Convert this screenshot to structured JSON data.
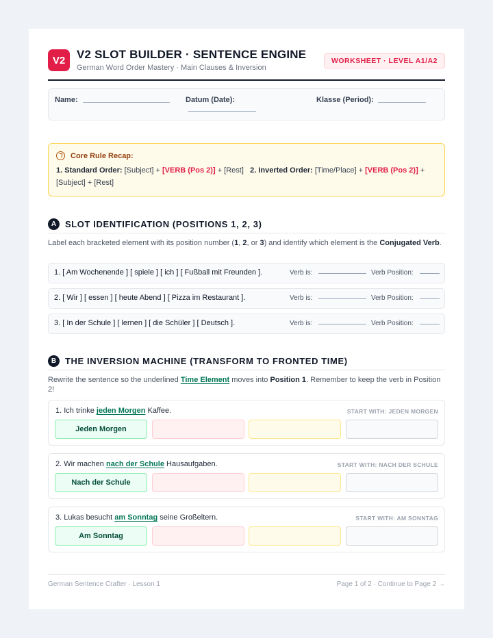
{
  "header": {
    "logo": "V2",
    "title": "V2 SLOT BUILDER · SENTENCE ENGINE",
    "subtitle": "German Word Order Mastery · Main Clauses & Inversion",
    "badge": "WORKSHEET · LEVEL A1/A2"
  },
  "info": {
    "name_label": "Name:",
    "date_label": "Datum (Date):",
    "class_label": "Klasse (Period):"
  },
  "recap": {
    "icon": "compass-icon",
    "heading": "Core Rule Recap:",
    "rule1_label": "1. Standard Order:",
    "rule1_a": "[Subject] +",
    "rule1_verb": "[VERB (Pos 2)]",
    "rule1_b": "+ [Rest]",
    "rule2_label": "2. Inverted Order:",
    "rule2_a": "[Time/Place] +",
    "rule2_verb": "[VERB (Pos 2)]",
    "rule2_b": "+ [Subject] + [Rest]"
  },
  "section_a": {
    "letter": "A",
    "title": "SLOT IDENTIFICATION (POSITIONS 1, 2, 3)",
    "desc_1": "Label each bracketed element with its position number (",
    "desc_n1": "1",
    "desc_sep1": ", ",
    "desc_n2": "2",
    "desc_sep2": ", or ",
    "desc_n3": "3",
    "desc_2": ") and identify which element is the ",
    "desc_bold": "Conjugated Verb",
    "desc_end": ".",
    "verb_is_label": "Verb is:",
    "verb_pos_label": "Verb Position:",
    "exercises": [
      "1. [ Am Wochenende ] [ spiele ] [ ich ] [ Fußball mit Freunden ].",
      "2. [ Wir ] [ essen ] [ heute Abend ] [ Pizza im Restaurant ].",
      "3. [ In der Schule ] [ lernen ] [ die Schüler ] [ Deutsch ]."
    ]
  },
  "section_b": {
    "letter": "B",
    "title": "THE INVERSION MACHINE (TRANSFORM TO FRONTED TIME)",
    "desc_1": "Rewrite the sentence so the underlined ",
    "desc_time": "Time Element",
    "desc_2": " moves into ",
    "desc_pos": "Position 1",
    "desc_3": ". Remember to keep the verb in Position 2!",
    "cards": [
      {
        "pre": "1. Ich trinke ",
        "time": "jeden Morgen",
        "post": " Kaffee.",
        "hint": "START WITH: JEDEN MORGEN",
        "slot1": "Jeden Morgen"
      },
      {
        "pre": "2. Wir machen ",
        "time": "nach der Schule",
        "post": " Hausaufgaben.",
        "hint": "START WITH: NACH DER SCHULE",
        "slot1": "Nach der Schule"
      },
      {
        "pre": "3. Lukas besucht ",
        "time": "am Sonntag",
        "post": " seine Großeltern.",
        "hint": "START WITH: AM SONNTAG",
        "slot1": "Am Sonntag"
      }
    ]
  },
  "footer": {
    "left": "German Sentence Crafter · Lesson 1",
    "right": "Page 1 of 2 · Continue to Page 2 →"
  },
  "colors": {
    "accent": "#e11d48",
    "time_green": "#047857",
    "recap_border": "#fcd34d"
  }
}
